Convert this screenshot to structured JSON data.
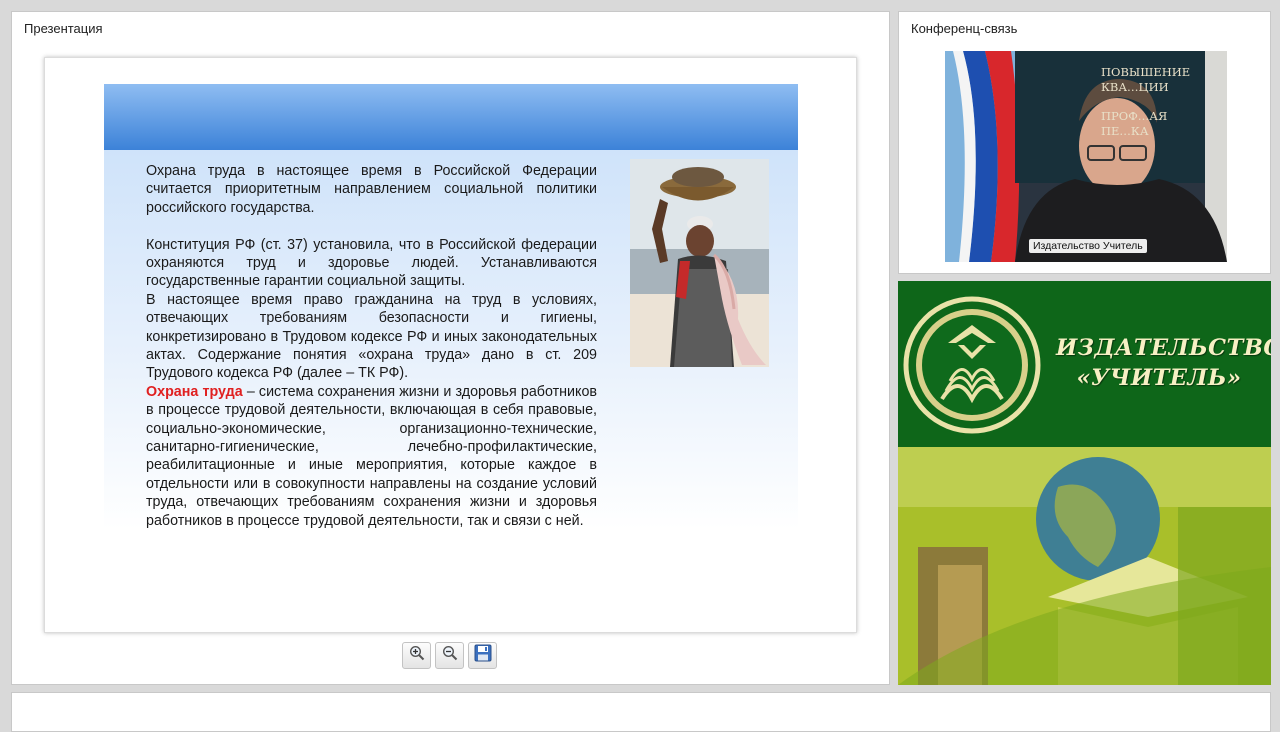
{
  "presentation_panel": {
    "title": "Презентация"
  },
  "slide": {
    "paragraphs": {
      "p1": "Охрана труда в настоящее время в Российской Федерации считается приоритетным направлением социальной политики российского государства.",
      "p2": "Конституция РФ (ст. 37) установила, что в Российской федерации охраняются труд и здоровье людей. Устанавливаются государственные гарантии социальной защиты.",
      "p3": "В настоящее время право гражданина на труд в условиях, отвечающих требованиям безопасности и гигиены, конкретизировано в Трудовом кодексе РФ и иных законодательных актах. Содержание понятия «охрана труда» дано в ст. 209 Трудового кодекса РФ (далее – ТК РФ).",
      "p4_term": "Охрана труда",
      "p4_rest": " – система сохранения жизни и здоровья работников в процессе трудовой деятельности, включающая в себя правовые, социально-экономические, организационно-технические, санитарно-гигиенические, лечебно-профилактические, реабилитационные и иные мероприятия, которые каждое в отдельности или в совокупности направлены на создание условий труда, отвечающих требованиям сохранения жизни и здоровья работников в процессе трудовой деятельности, так и связи с ней."
    },
    "photo_description_icon": "woman-carrying-basket-photo"
  },
  "toolbar": {
    "zoom_in_icon": "zoom-in-icon",
    "zoom_out_icon": "zoom-out-icon",
    "save_icon": "floppy-disk-icon"
  },
  "conference_panel": {
    "title": "Конференц-связь",
    "speaker_name": "Издательство Учитель",
    "background_sign_text": [
      "ПОВЫШЕНИЕ",
      "КВА…ЦИИ",
      "ПРОФ…АЯ",
      "ПЕ…КА"
    ]
  },
  "ad_banner": {
    "brand_line1": "ИЗДАТЕЛЬСТВО",
    "brand_line2": "«УЧИТЕЛЬ»"
  },
  "colors": {
    "accent_red": "#e02020",
    "header_blue": "#3c82d8",
    "brand_green": "#0e6619",
    "brand_cream": "#f7f0c4"
  }
}
